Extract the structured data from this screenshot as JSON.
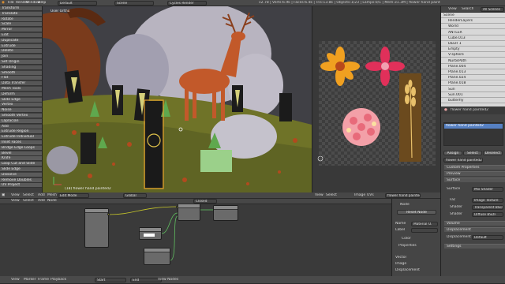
{
  "topbar": {
    "menus": [
      "File",
      "Render",
      "Window",
      "Help"
    ],
    "layout": "Default",
    "scene": "Scene",
    "engine": "Cycles Render",
    "stats": "v2.78 | Verts:6.9k | Faces:6.4k | Tris:13.8k | Objects:1/23 | Lamps:0/1 | Mem:31.3M | flower hand painted2"
  },
  "tool_shelf": {
    "rows": [
      "Transform",
      "Translate",
      "Rotate",
      "Scale",
      "Mirror",
      "Edit",
      "Duplicate",
      "Extrude",
      "Delete",
      "Join",
      "Set Origin",
      "Shading",
      "Smooth",
      "Flat",
      "Data Transfer",
      "Mesh Tools",
      "Deform",
      "Slide Edge",
      "Vertex",
      "Noise",
      "Smooth Vertex",
      "Laplacian",
      "Add",
      "Extrude Region",
      "Extrude Individual",
      "Inset Faces",
      "Bridge Edge Loops",
      "Bevel",
      "Knife",
      "Loop Cut and Slide",
      "Slide Edge",
      "Dissolve",
      "Remove Doubles",
      "UV Project"
    ],
    "values": [
      "1.210",
      "1.210",
      "1.210"
    ]
  },
  "viewport": {
    "label": "User Ortho",
    "object_info": "(18) flower hand painted2",
    "header_items": [
      "View",
      "Select",
      "Add",
      "Mesh",
      "Edit Mode",
      "Global"
    ]
  },
  "uv_editor": {
    "header_items": [
      "View",
      "Image",
      "UVs",
      "flower hand painted2"
    ],
    "footer_items": [
      "View",
      "Select",
      "Image",
      "UVs",
      "flower hand painted2",
      "View",
      "Image"
    ]
  },
  "outliner": {
    "tabs": [
      "View",
      "Search",
      "All Scenes"
    ],
    "items": [
      "Scene",
      "RenderLayers",
      "World",
      "ANTLER",
      "Cube.013",
      "DEER 1",
      "Empty",
      "V-sphere",
      "NurbsPath",
      "Plane.004",
      "Plane.013",
      "Plane.024",
      "Plane.018",
      "Sun",
      "Sun.001",
      "butterfly"
    ]
  },
  "properties": {
    "material_slot": "flower hand painted2",
    "buttons": [
      "Assign",
      "Select",
      "Deselect"
    ],
    "material_name": "flower hand painted2",
    "sections": [
      "Custom Properties",
      "Preview",
      "Surface",
      "Volume",
      "Displacement",
      "Settings"
    ],
    "surface_label": "Surface",
    "surface_value": "Mix Shader",
    "fac_label": "Fac",
    "fac_value": "Image Texture",
    "shader1_label": "Shader",
    "shader1_value": "Transparent BSDF",
    "shader2_label": "Shader",
    "shader2_value": "Diffuse BSDF",
    "displacement_label": "Displacement",
    "displacement_value": "Default"
  },
  "node_editor": {
    "header_items": [
      "View",
      "Select",
      "Add",
      "Node",
      "Closed"
    ],
    "sidebar": {
      "tabs": [
        "Node",
        "Reset Node"
      ],
      "name_label": "Name",
      "name_value": "Material O.",
      "label_label": "Label",
      "color_label": "Color",
      "properties_label": "Properties",
      "inputs": [
        "Vector",
        "Image",
        "Displacement"
      ]
    },
    "node_labels": [
      "Image Texture",
      "Mix Shader",
      "Material Output",
      "Transparent BSDF",
      "Diffuse BSDF"
    ]
  },
  "timeline": {
    "items": [
      "View",
      "Marker",
      "Frame",
      "Playback",
      "Start",
      "End",
      "View Nodes"
    ]
  },
  "colors": {
    "accent": "#5680c2",
    "socket": "#c7c729",
    "background": "#2b2b2b"
  }
}
